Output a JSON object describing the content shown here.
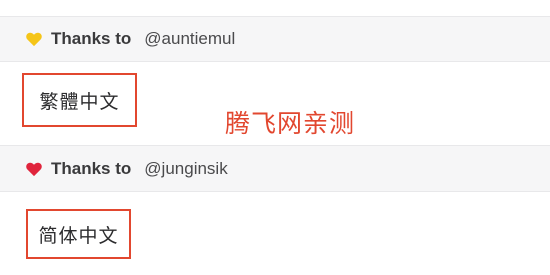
{
  "sections": [
    {
      "heart_color": "#f5c518",
      "heart_icon": "yellow-heart-icon",
      "thanks_label": "Thanks to",
      "user": "@auntiemul",
      "language": "繁體中文"
    },
    {
      "heart_color": "#e0243c",
      "heart_icon": "red-heart-icon",
      "thanks_label": "Thanks to",
      "user": "@junginsik",
      "language": "简体中文"
    }
  ],
  "watermark": "腾飞网亲测",
  "colors": {
    "highlight_border": "#e2472f",
    "watermark": "#e2472f",
    "header_bg": "#f6f6f7"
  }
}
